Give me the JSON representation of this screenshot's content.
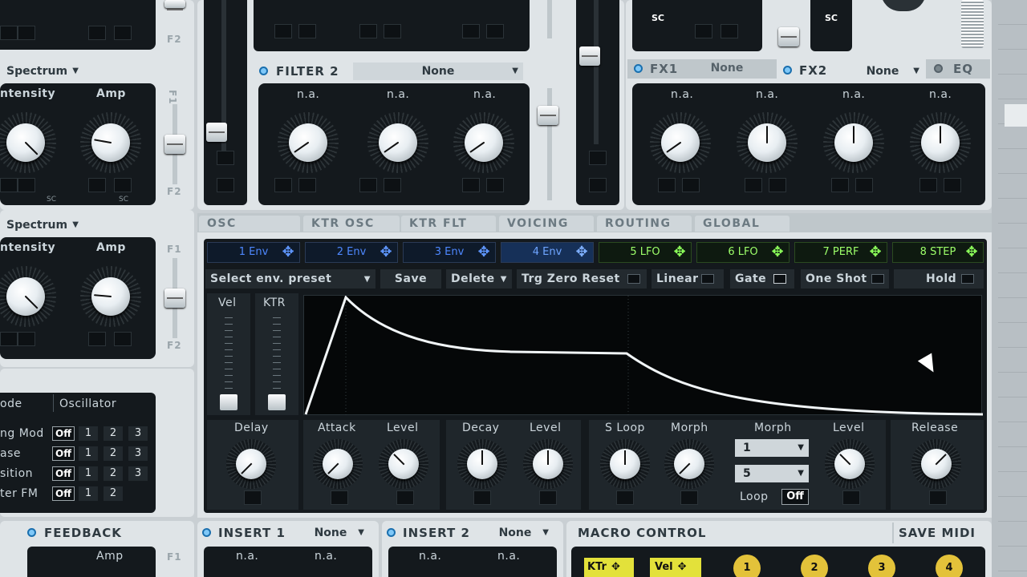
{
  "filter_left": {
    "mode_label": "Spectrum",
    "knob_labels": [
      "ntensity",
      "Amp"
    ],
    "side_labels": [
      "F1",
      "F2"
    ],
    "sc_label": "SC"
  },
  "filter_left2": {
    "mode_label": "Spectrum",
    "knob_labels": [
      "ntensity",
      "Amp"
    ],
    "side_labels": [
      "F1",
      "F2"
    ]
  },
  "filter2": {
    "title": "FILTER 2",
    "type": "None",
    "knob_labels": [
      "n.a.",
      "n.a.",
      "n.a."
    ]
  },
  "fx": {
    "fx1": "FX1",
    "fx1_type": "None",
    "fx2": "FX2",
    "fx2_type": "None",
    "eq": "EQ",
    "knob_labels": [
      "n.a.",
      "n.a.",
      "n.a.",
      "n.a."
    ]
  },
  "tabs": [
    "OSC",
    "KTR OSC",
    "KTR FLT",
    "VOICING",
    "ROUTING",
    "GLOBAL"
  ],
  "env_tabs": [
    "1 Env",
    "2 Env",
    "3 Env",
    "4 Env",
    "5 LFO",
    "6 LFO",
    "7 PERF",
    "8 STEP"
  ],
  "toolbar": {
    "preset": "Select env. preset",
    "save": "Save",
    "delete": "Delete",
    "trg": "Trg Zero Reset",
    "linear": "Linear",
    "gate": "Gate",
    "oneshot": "One Shot",
    "hold": "Hold"
  },
  "env_sliders": [
    "Vel",
    "KTR"
  ],
  "env_knobs": {
    "delay": "Delay",
    "attack": "Attack",
    "level1": "Level",
    "decay": "Decay",
    "level2": "Level",
    "sloop": "S Loop",
    "morph1": "Morph",
    "morph2": "Morph",
    "level3": "Level",
    "release": "Release"
  },
  "morph_selects": [
    "1",
    "5"
  ],
  "loop": {
    "label": "Loop",
    "value": "Off"
  },
  "osc_table": {
    "headers": [
      "ode",
      "Oscillator"
    ],
    "rows": [
      {
        "name": "ng Mod",
        "off": "Off",
        "nums": [
          "1",
          "2",
          "3"
        ]
      },
      {
        "name": "ase",
        "off": "Off",
        "nums": [
          "1",
          "2",
          "3"
        ]
      },
      {
        "name": "sition",
        "off": "Off",
        "nums": [
          "1",
          "2",
          "3"
        ]
      },
      {
        "name": "ter FM",
        "off": "Off",
        "nums": [
          "1",
          "2"
        ]
      }
    ]
  },
  "bottom": {
    "feedback": "FEEDBACK",
    "feedback_amp": "Amp",
    "feedback_side": "F1",
    "insert1": "INSERT 1",
    "insert1_type": "None",
    "insert1_knobs": [
      "n.a.",
      "n.a."
    ],
    "insert2": "INSERT 2",
    "insert2_type": "None",
    "insert2_knobs": [
      "n.a.",
      "n.a."
    ],
    "macro": "MACRO CONTROL",
    "save_midi": "SAVE MIDI",
    "macro_buttons": [
      "KTr",
      "Vel"
    ],
    "macro_nums": [
      "1",
      "2",
      "3",
      "4"
    ]
  },
  "top_sc": "SC"
}
